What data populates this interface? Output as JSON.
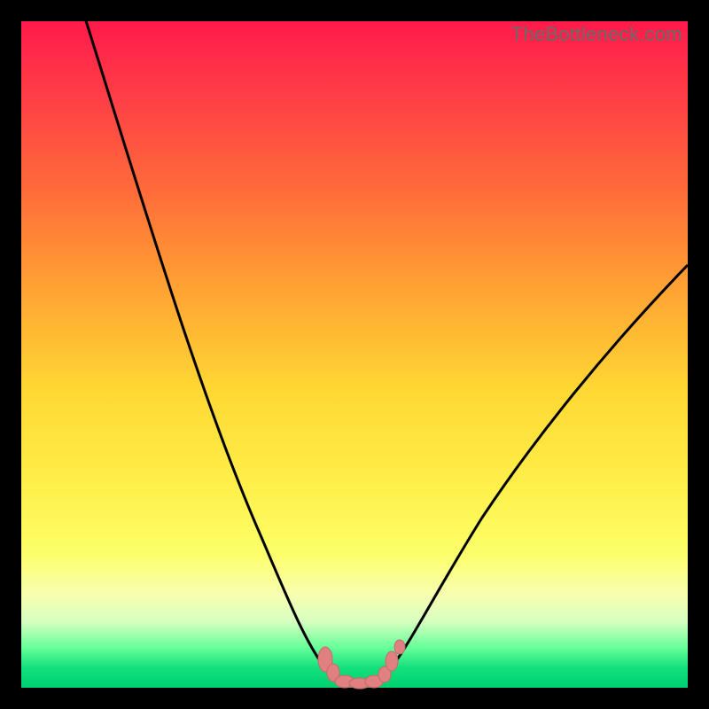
{
  "watermark": "TheBottleneck.com",
  "colors": {
    "border": "#000000",
    "curve": "#000000",
    "bump_fill": "#e08080",
    "bump_stroke": "#c86868",
    "gradient_stops": [
      "#ff1a4b",
      "#ff3a47",
      "#ff6a3a",
      "#ffa233",
      "#ffd733",
      "#fff04a",
      "#fcff6a",
      "#f7ffb0",
      "#d8ffc0",
      "#66ff99",
      "#14e07e",
      "#00d070"
    ]
  },
  "chart_data": {
    "type": "line",
    "title": "",
    "xlabel": "",
    "ylabel": "",
    "ylim": [
      0,
      100
    ],
    "series": [
      {
        "name": "left-curve",
        "x": [
          0.1,
          0.14,
          0.18,
          0.22,
          0.26,
          0.3,
          0.34,
          0.38,
          0.42,
          0.44,
          0.46
        ],
        "values": [
          100,
          88,
          76,
          64,
          52,
          40,
          28,
          17,
          7,
          3,
          0
        ]
      },
      {
        "name": "right-curve",
        "x": [
          0.54,
          0.56,
          0.6,
          0.66,
          0.72,
          0.78,
          0.84,
          0.9,
          0.96,
          1.0
        ],
        "values": [
          0,
          3,
          9,
          18,
          27,
          36,
          45,
          53,
          60,
          65
        ]
      },
      {
        "name": "bottom-bump",
        "x": [
          0.44,
          0.46,
          0.48,
          0.5,
          0.52,
          0.54,
          0.56
        ],
        "values": [
          3,
          1,
          0.5,
          0.5,
          0.5,
          2,
          4
        ]
      }
    ]
  }
}
